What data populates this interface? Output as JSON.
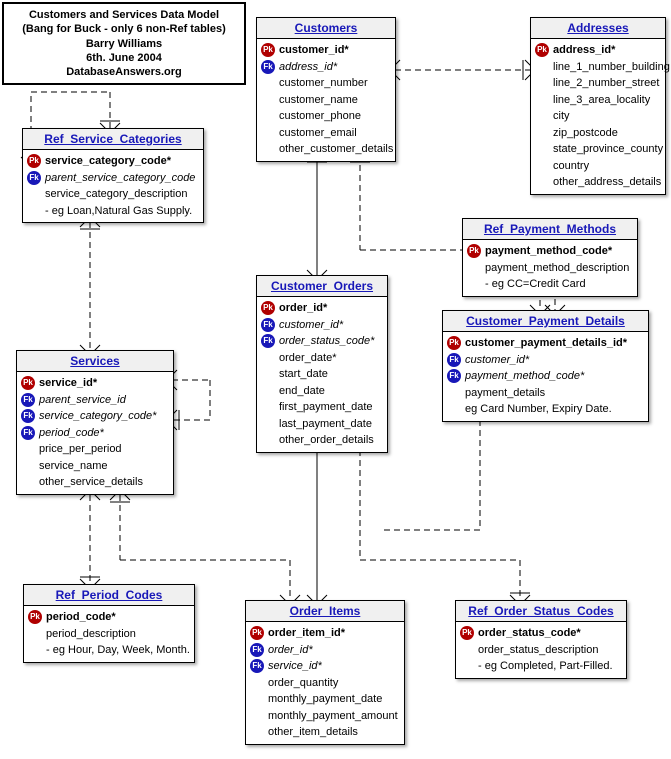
{
  "title_box": {
    "l1": "Customers and Services Data Model",
    "l2": "(Bang for Buck - only 6 non-Ref tables)",
    "l3": "Barry Williams",
    "l4": "6th. June 2004",
    "l5": "DatabaseAnswers.org"
  },
  "entities": {
    "customers": {
      "title": "Customers",
      "attrs": [
        {
          "key": "pk",
          "text": "customer_id*",
          "bold": true
        },
        {
          "key": "fk",
          "text": "address_id*",
          "italic": true
        },
        {
          "key": "",
          "text": "customer_number"
        },
        {
          "key": "",
          "text": "customer_name"
        },
        {
          "key": "",
          "text": "customer_phone"
        },
        {
          "key": "",
          "text": "customer_email"
        },
        {
          "key": "",
          "text": "other_customer_details"
        }
      ]
    },
    "addresses": {
      "title": "Addresses",
      "attrs": [
        {
          "key": "pk",
          "text": "address_id*",
          "bold": true
        },
        {
          "key": "",
          "text": "line_1_number_building"
        },
        {
          "key": "",
          "text": "line_2_number_street"
        },
        {
          "key": "",
          "text": "line_3_area_locality"
        },
        {
          "key": "",
          "text": "city"
        },
        {
          "key": "",
          "text": "zip_postcode"
        },
        {
          "key": "",
          "text": "state_province_county"
        },
        {
          "key": "",
          "text": "country"
        },
        {
          "key": "",
          "text": "other_address_details"
        }
      ]
    },
    "ref_service_categories": {
      "title": "Ref_Service_Categories",
      "attrs": [
        {
          "key": "pk",
          "text": "service_category_code*",
          "bold": true
        },
        {
          "key": "fk",
          "text": "parent_service_category_code",
          "italic": true
        },
        {
          "key": "",
          "text": "service_category_description"
        },
        {
          "key": "",
          "text": "- eg Loan,Natural Gas Supply."
        }
      ]
    },
    "ref_payment_methods": {
      "title": "Ref_Payment_Methods",
      "attrs": [
        {
          "key": "pk",
          "text": "payment_method_code*",
          "bold": true
        },
        {
          "key": "",
          "text": "payment_method_description"
        },
        {
          "key": "",
          "text": "- eg CC=Credit Card"
        }
      ]
    },
    "customer_orders": {
      "title": "Customer_Orders",
      "attrs": [
        {
          "key": "pk",
          "text": "order_id*",
          "bold": true
        },
        {
          "key": "fk",
          "text": "customer_id*",
          "italic": true
        },
        {
          "key": "fk",
          "text": "order_status_code*",
          "italic": true
        },
        {
          "key": "",
          "text": "order_date*"
        },
        {
          "key": "",
          "text": "start_date"
        },
        {
          "key": "",
          "text": "end_date"
        },
        {
          "key": "",
          "text": "first_payment_date"
        },
        {
          "key": "",
          "text": "last_payment_date"
        },
        {
          "key": "",
          "text": "other_order_details"
        }
      ]
    },
    "customer_payment_details": {
      "title": "Customer_Payment_Details",
      "attrs": [
        {
          "key": "pk",
          "text": "customer_payment_details_id*",
          "bold": true
        },
        {
          "key": "fk",
          "text": "customer_id*",
          "italic": true
        },
        {
          "key": "fk",
          "text": "payment_method_code*",
          "italic": true
        },
        {
          "key": "",
          "text": "payment_details"
        },
        {
          "key": "",
          "text": "eg Card Number, Expiry Date."
        }
      ]
    },
    "services": {
      "title": "Services",
      "attrs": [
        {
          "key": "pk",
          "text": "service_id*",
          "bold": true
        },
        {
          "key": "fk",
          "text": "parent_service_id",
          "italic": true
        },
        {
          "key": "fk",
          "text": "service_category_code*",
          "italic": true
        },
        {
          "key": "fk",
          "text": "period_code*",
          "italic": true
        },
        {
          "key": "",
          "text": "price_per_period"
        },
        {
          "key": "",
          "text": "service_name"
        },
        {
          "key": "",
          "text": "other_service_details"
        }
      ]
    },
    "ref_period_codes": {
      "title": "Ref_Period_Codes",
      "attrs": [
        {
          "key": "pk",
          "text": "period_code*",
          "bold": true
        },
        {
          "key": "",
          "text": "period_description"
        },
        {
          "key": "",
          "text": "- eg Hour, Day, Week, Month."
        }
      ]
    },
    "order_items": {
      "title": "Order_Items",
      "attrs": [
        {
          "key": "pk",
          "text": "order_item_id*",
          "bold": true
        },
        {
          "key": "fk",
          "text": "order_id*",
          "italic": true
        },
        {
          "key": "fk",
          "text": "service_id*",
          "italic": true
        },
        {
          "key": "",
          "text": "order_quantity"
        },
        {
          "key": "",
          "text": "monthly_payment_date"
        },
        {
          "key": "",
          "text": "monthly_payment_amount"
        },
        {
          "key": "",
          "text": "other_item_details"
        }
      ]
    },
    "ref_order_status_codes": {
      "title": "Ref_Order_Status_Codes",
      "attrs": [
        {
          "key": "pk",
          "text": "order_status_code*",
          "bold": true
        },
        {
          "key": "",
          "text": "order_status_description"
        },
        {
          "key": "",
          "text": "- eg Completed, Part-Filled."
        }
      ]
    }
  }
}
